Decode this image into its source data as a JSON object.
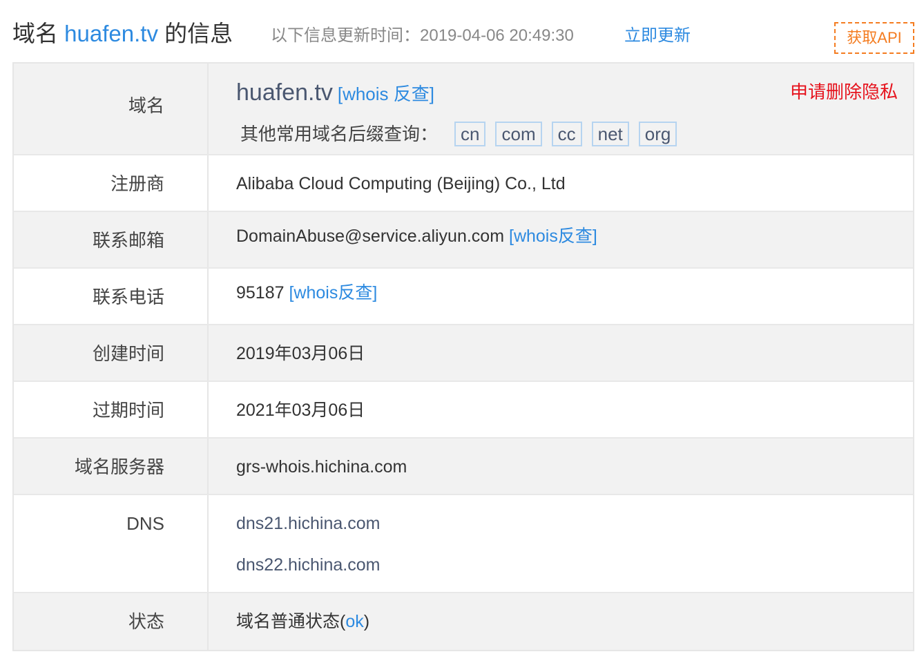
{
  "header": {
    "title_prefix": "域名 ",
    "domain": "huafen.tv",
    "title_suffix": " 的信息",
    "updated_text": "以下信息更新时间：2019-04-06 20:49:30",
    "refresh_label": "立即更新",
    "api_label": "获取API"
  },
  "rows": {
    "domain": {
      "label": "域名",
      "value": "huafen.tv",
      "whois_link": "[whois 反查]",
      "privacy_link": "申请删除隐私",
      "suffix_label": "其他常用域名后缀查询：",
      "suffixes": [
        "cn",
        "com",
        "cc",
        "net",
        "org"
      ]
    },
    "registrar": {
      "label": "注册商",
      "value": "Alibaba Cloud Computing (Beijing) Co., Ltd"
    },
    "email": {
      "label": "联系邮箱",
      "value": "DomainAbuse@service.aliyun.com",
      "whois_link": "[whois反查]"
    },
    "phone": {
      "label": "联系电话",
      "value": "95187",
      "whois_link": "[whois反查]"
    },
    "created": {
      "label": "创建时间",
      "value": "2019年03月06日"
    },
    "expires": {
      "label": "过期时间",
      "value": "2021年03月06日"
    },
    "whois_server": {
      "label": "域名服务器",
      "value": "grs-whois.hichina.com"
    },
    "dns": {
      "label": "DNS",
      "values": [
        "dns21.hichina.com",
        "dns22.hichina.com"
      ]
    },
    "status": {
      "label": "状态",
      "value_prefix": "域名普通状态(",
      "value_code": "ok",
      "value_suffix": ")"
    }
  },
  "colors": {
    "link": "#2d8ae0",
    "privacy": "#e6141e",
    "api": "#f47c20",
    "row_gray": "#f2f2f2"
  }
}
